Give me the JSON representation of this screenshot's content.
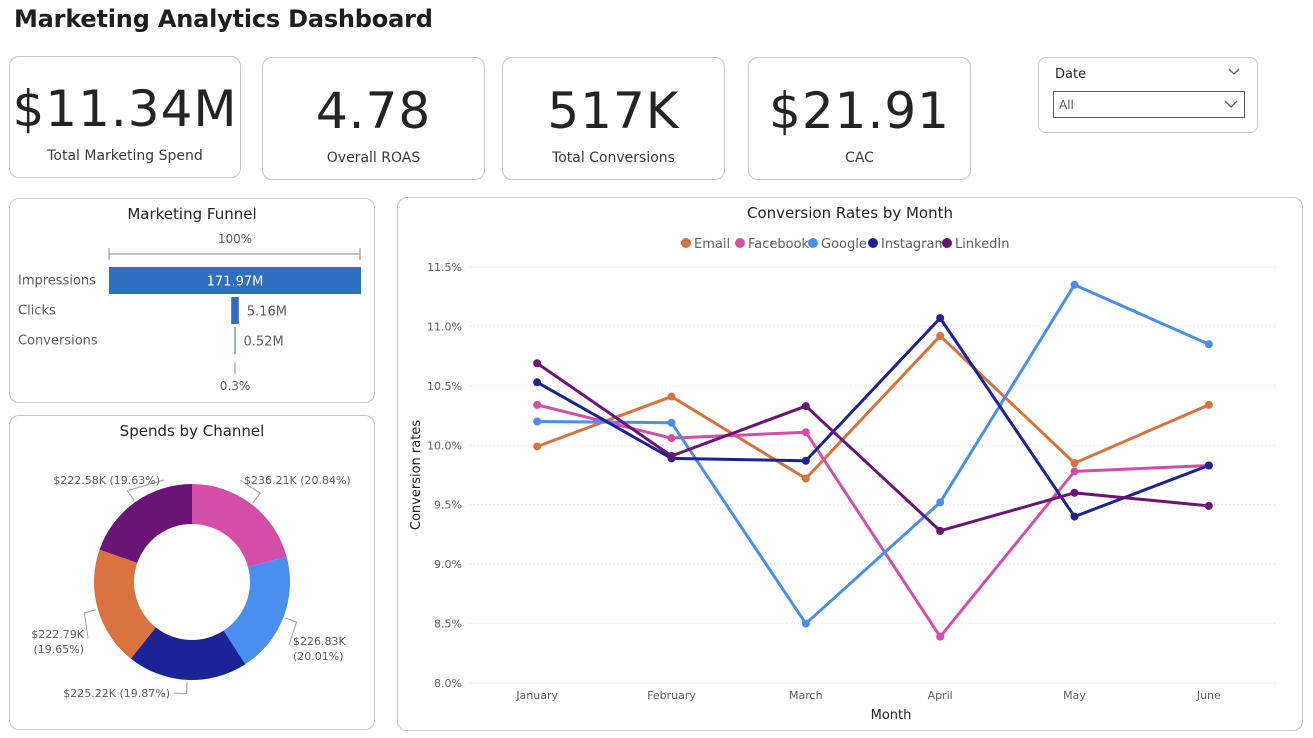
{
  "dashboard": {
    "title": "Marketing Analytics Dashboard"
  },
  "kpis": {
    "spend": {
      "value": "$11.34M",
      "label": "Total Marketing Spend"
    },
    "roas": {
      "value": "4.78",
      "label": "Overall ROAS"
    },
    "conversions": {
      "value": "517K",
      "label": "Total Conversions"
    },
    "cac": {
      "value": "$21.91",
      "label": "CAC"
    }
  },
  "slicer": {
    "title": "Date",
    "selected": "All",
    "icon": "chevron-down-icon"
  },
  "colors": {
    "Email": "#d8733f",
    "Facebook": "#d34fa7",
    "Google": "#4a8ff0",
    "Instagram": "#1c2395",
    "LinkedIn": "#6b1478",
    "funnel_bar": "#2f6fc2"
  },
  "chart_data": [
    {
      "type": "bar",
      "title": "Marketing Funnel",
      "top_label": "100%",
      "bottom_label": "0.3%",
      "categories": [
        "Impressions",
        "Clicks",
        "Conversions"
      ],
      "values": [
        171.97,
        5.16,
        0.52
      ],
      "value_labels": [
        "171.97M",
        "5.16M",
        "0.52M"
      ],
      "unit": "M"
    },
    {
      "type": "pie",
      "title": "Spends by Channel",
      "donut": true,
      "slices": [
        {
          "name": "Facebook",
          "value": 236.21,
          "label": "$236.21K (20.84%)"
        },
        {
          "name": "Google",
          "value": 226.83,
          "label": "$226.83K (20.01%)"
        },
        {
          "name": "Instagram",
          "value": 225.22,
          "label": "$225.22K (19.87%)"
        },
        {
          "name": "Email",
          "value": 222.79,
          "label": "$222.79K (19.65%)"
        },
        {
          "name": "LinkedIn",
          "value": 222.58,
          "label": "$222.58K (19.63%)"
        }
      ]
    },
    {
      "type": "line",
      "title": "Conversion Rates by Month",
      "xlabel": "Month",
      "ylabel": "Conversion rates",
      "categories": [
        "January",
        "February",
        "March",
        "April",
        "May",
        "June"
      ],
      "ylim": [
        8.0,
        11.5
      ],
      "yticks": [
        "8.0%",
        "8.5%",
        "9.0%",
        "9.5%",
        "10.0%",
        "10.5%",
        "11.0%",
        "11.5%"
      ],
      "grid": true,
      "legend": "top-center",
      "series": [
        {
          "name": "Email",
          "values": [
            9.99,
            10.41,
            9.72,
            10.92,
            9.85,
            10.34
          ]
        },
        {
          "name": "Facebook",
          "values": [
            10.34,
            10.06,
            10.11,
            8.39,
            9.78,
            9.83
          ]
        },
        {
          "name": "Google",
          "values": [
            10.2,
            10.19,
            8.5,
            9.52,
            11.35,
            10.85
          ]
        },
        {
          "name": "Instagram",
          "values": [
            10.53,
            9.89,
            9.87,
            11.07,
            9.4,
            9.83
          ]
        },
        {
          "name": "LinkedIn",
          "values": [
            10.69,
            9.91,
            10.33,
            9.28,
            9.6,
            9.49
          ]
        }
      ]
    }
  ]
}
